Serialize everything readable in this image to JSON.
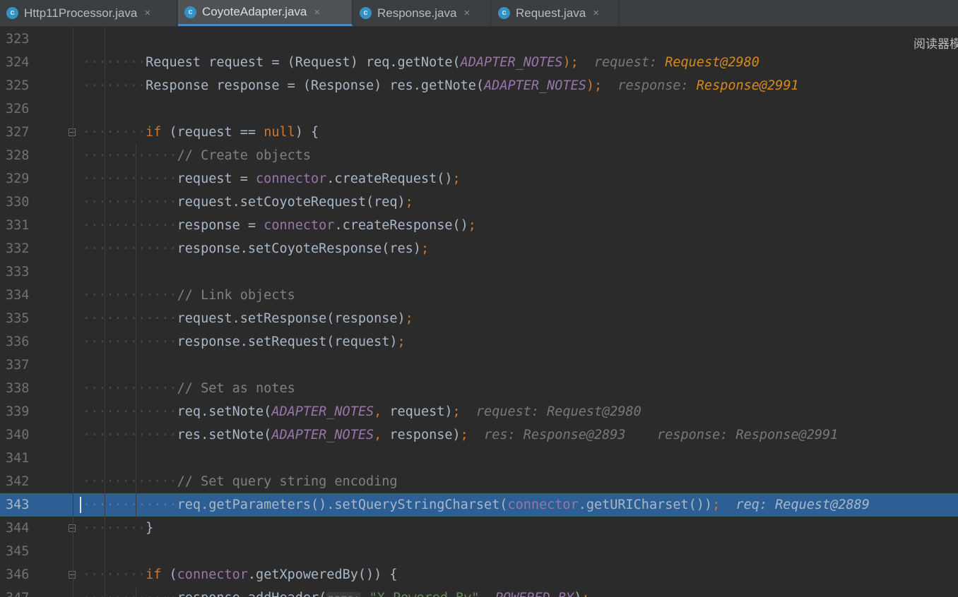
{
  "tabs": [
    {
      "icon": "class-icon",
      "label": "Http11Processor.java",
      "active": false
    },
    {
      "icon": "class-icon",
      "label": "CoyoteAdapter.java",
      "active": true
    },
    {
      "icon": "class-icon",
      "label": "Response.java",
      "active": false
    },
    {
      "icon": "class-icon",
      "label": "Request.java",
      "active": false
    }
  ],
  "tab_icon_letter": "c",
  "close_glyph": "×",
  "reader_mode_label": "阅读器模",
  "current_line": 343,
  "colors": {
    "keyword": "#cc7832",
    "field": "#9876aa",
    "comment": "#808080",
    "string": "#6a8759",
    "text": "#a9b7c6",
    "hint_value_orange": "#d78a1c",
    "current_line_bg": "#2d5f95",
    "active_tab_underline": "#4a88c7"
  },
  "lines": [
    {
      "n": 323,
      "indent": 0,
      "fold": false,
      "tokens": []
    },
    {
      "n": 324,
      "indent": 2,
      "fold": false,
      "tokens": [
        {
          "t": "Request request = (Request) req.getNote(",
          "c": ""
        },
        {
          "t": "ADAPTER_NOTES",
          "c": "cst"
        },
        {
          "t": ");",
          "c": "kw"
        },
        {
          "t": "  ",
          "c": ""
        },
        {
          "t": "request: ",
          "c": "hint"
        },
        {
          "t": "Request@2980",
          "c": "hint-orange"
        }
      ]
    },
    {
      "n": 325,
      "indent": 2,
      "fold": false,
      "tokens": [
        {
          "t": "Response response = (Response) res.getNote(",
          "c": ""
        },
        {
          "t": "ADAPTER_NOTES",
          "c": "cst"
        },
        {
          "t": ");",
          "c": "kw"
        },
        {
          "t": "  ",
          "c": ""
        },
        {
          "t": "response: ",
          "c": "hint"
        },
        {
          "t": "Response@2991",
          "c": "hint-orange"
        }
      ]
    },
    {
      "n": 326,
      "indent": 0,
      "fold": false,
      "tokens": []
    },
    {
      "n": 327,
      "indent": 2,
      "fold": true,
      "tokens": [
        {
          "t": "if",
          "c": "kw"
        },
        {
          "t": " (request == ",
          "c": ""
        },
        {
          "t": "null",
          "c": "kw"
        },
        {
          "t": ") {",
          "c": ""
        }
      ]
    },
    {
      "n": 328,
      "indent": 3,
      "fold": false,
      "tokens": [
        {
          "t": "// Create objects",
          "c": "cmt"
        }
      ]
    },
    {
      "n": 329,
      "indent": 3,
      "fold": false,
      "tokens": [
        {
          "t": "request = ",
          "c": ""
        },
        {
          "t": "connector",
          "c": "fld"
        },
        {
          "t": ".createRequest()",
          "c": ""
        },
        {
          "t": ";",
          "c": "kw"
        }
      ]
    },
    {
      "n": 330,
      "indent": 3,
      "fold": false,
      "tokens": [
        {
          "t": "request.setCoyoteRequest(req)",
          "c": ""
        },
        {
          "t": ";",
          "c": "kw"
        }
      ]
    },
    {
      "n": 331,
      "indent": 3,
      "fold": false,
      "tokens": [
        {
          "t": "response = ",
          "c": ""
        },
        {
          "t": "connector",
          "c": "fld"
        },
        {
          "t": ".createResponse()",
          "c": ""
        },
        {
          "t": ";",
          "c": "kw"
        }
      ]
    },
    {
      "n": 332,
      "indent": 3,
      "fold": false,
      "tokens": [
        {
          "t": "response.setCoyoteResponse(res)",
          "c": ""
        },
        {
          "t": ";",
          "c": "kw"
        }
      ]
    },
    {
      "n": 333,
      "indent": 0,
      "fold": false,
      "tokens": []
    },
    {
      "n": 334,
      "indent": 3,
      "fold": false,
      "tokens": [
        {
          "t": "// Link objects",
          "c": "cmt"
        }
      ]
    },
    {
      "n": 335,
      "indent": 3,
      "fold": false,
      "tokens": [
        {
          "t": "request.setResponse(response)",
          "c": ""
        },
        {
          "t": ";",
          "c": "kw"
        }
      ]
    },
    {
      "n": 336,
      "indent": 3,
      "fold": false,
      "tokens": [
        {
          "t": "response.setRequest(request)",
          "c": ""
        },
        {
          "t": ";",
          "c": "kw"
        }
      ]
    },
    {
      "n": 337,
      "indent": 0,
      "fold": false,
      "tokens": []
    },
    {
      "n": 338,
      "indent": 3,
      "fold": false,
      "tokens": [
        {
          "t": "// Set as notes",
          "c": "cmt"
        }
      ]
    },
    {
      "n": 339,
      "indent": 3,
      "fold": false,
      "tokens": [
        {
          "t": "req.setNote(",
          "c": ""
        },
        {
          "t": "ADAPTER_NOTES",
          "c": "cst"
        },
        {
          "t": ", ",
          "c": "kw"
        },
        {
          "t": "request)",
          "c": ""
        },
        {
          "t": ";",
          "c": "kw"
        },
        {
          "t": "  ",
          "c": ""
        },
        {
          "t": "request: Request@2980",
          "c": "hint"
        }
      ]
    },
    {
      "n": 340,
      "indent": 3,
      "fold": false,
      "tokens": [
        {
          "t": "res.setNote(",
          "c": ""
        },
        {
          "t": "ADAPTER_NOTES",
          "c": "cst"
        },
        {
          "t": ", ",
          "c": "kw"
        },
        {
          "t": "response)",
          "c": ""
        },
        {
          "t": ";",
          "c": "kw"
        },
        {
          "t": "  ",
          "c": ""
        },
        {
          "t": "res: Response@2893    response: Response@2991",
          "c": "hint"
        }
      ]
    },
    {
      "n": 341,
      "indent": 0,
      "fold": false,
      "tokens": []
    },
    {
      "n": 342,
      "indent": 3,
      "fold": false,
      "tokens": [
        {
          "t": "// Set query string encoding",
          "c": "cmt"
        }
      ]
    },
    {
      "n": 343,
      "indent": 3,
      "fold": false,
      "tokens": [
        {
          "t": "req.getParameters().setQueryStringCharset(",
          "c": ""
        },
        {
          "t": "connector",
          "c": "fld"
        },
        {
          "t": ".getURICharset())",
          "c": ""
        },
        {
          "t": ";",
          "c": "kw"
        },
        {
          "t": "  ",
          "c": ""
        },
        {
          "t": "req: Request@2889",
          "c": "hint"
        }
      ]
    },
    {
      "n": 344,
      "indent": 2,
      "fold": true,
      "tokens": [
        {
          "t": "}",
          "c": ""
        }
      ]
    },
    {
      "n": 345,
      "indent": 0,
      "fold": false,
      "tokens": []
    },
    {
      "n": 346,
      "indent": 2,
      "fold": true,
      "tokens": [
        {
          "t": "if",
          "c": "kw"
        },
        {
          "t": " (",
          "c": ""
        },
        {
          "t": "connector",
          "c": "fld"
        },
        {
          "t": ".getXpoweredBy()) {",
          "c": ""
        }
      ]
    },
    {
      "n": 347,
      "indent": 3,
      "fold": false,
      "tokens": [
        {
          "t": "response.addHeader(",
          "c": ""
        },
        {
          "t": "name:",
          "c": "pname"
        },
        {
          "t": " ",
          "c": ""
        },
        {
          "t": "\"X-Powered-By\"",
          "c": "str"
        },
        {
          "t": ", ",
          "c": "kw"
        },
        {
          "t": "POWERED_BY",
          "c": "cst"
        },
        {
          "t": ")",
          "c": ""
        },
        {
          "t": ";",
          "c": "kw"
        }
      ]
    }
  ]
}
